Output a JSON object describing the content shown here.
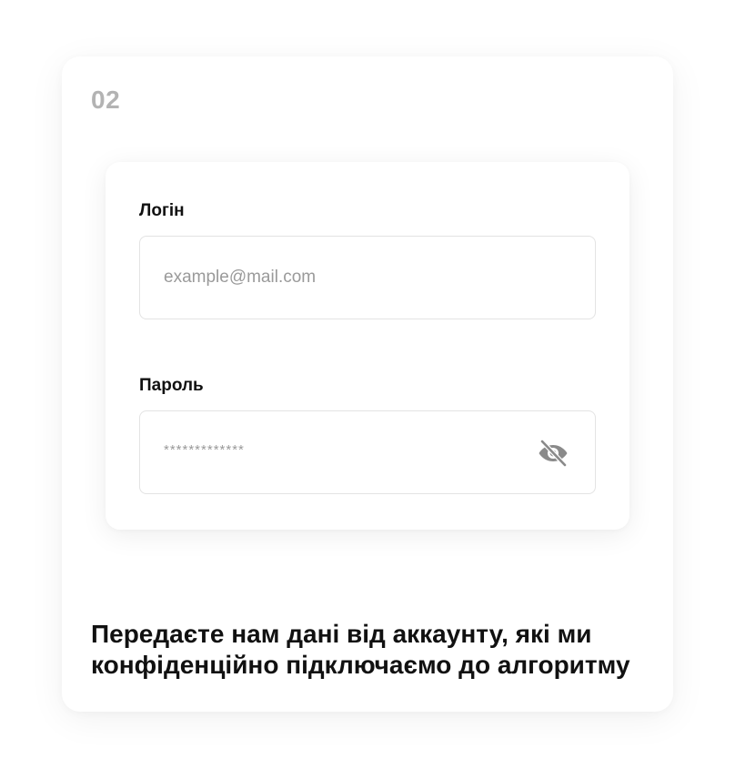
{
  "step": {
    "number": "02"
  },
  "form": {
    "login": {
      "label": "Логін",
      "placeholder": "example@mail.com"
    },
    "password": {
      "label": "Пароль",
      "value": "*************",
      "toggle_icon": "eye-off-icon"
    }
  },
  "description": {
    "line1": "Передаєте нам дані від аккаунту, які ми",
    "line2": "конфіденційно підключаємо до алгоритму"
  },
  "colors": {
    "text": "#111111",
    "muted": "#b3b3b3",
    "placeholder": "#9a9a9a",
    "border": "#e3e3e3",
    "icon": "#8a8a8a"
  }
}
